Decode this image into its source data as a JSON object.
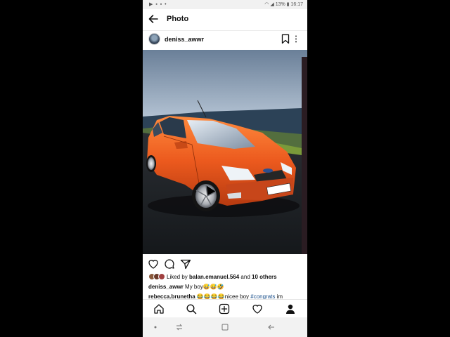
{
  "status_bar": {
    "left_icons": [
      "play-icon",
      "gallery-icon",
      "image-icon",
      "dot-icon"
    ],
    "battery": "13%",
    "time": "16:17"
  },
  "title_bar": {
    "title": "Photo"
  },
  "post": {
    "username": "deniss_awwr",
    "likes": {
      "prefix": "Liked by",
      "user": "balan.emanuel.564",
      "middle": "and",
      "others": "10 others"
    },
    "caption": {
      "user": "deniss_awwr",
      "text": "My boy😅😅🤣"
    },
    "comment": {
      "user": "rebecca.brunetha",
      "text": " 😂😂😂😂nicee boy ",
      "hashtag": "#congrats",
      "rest": " im"
    }
  },
  "colors": {
    "accent_link": "#1a4f8b",
    "car_orange": "#ec5a1e",
    "text": "#111111"
  }
}
